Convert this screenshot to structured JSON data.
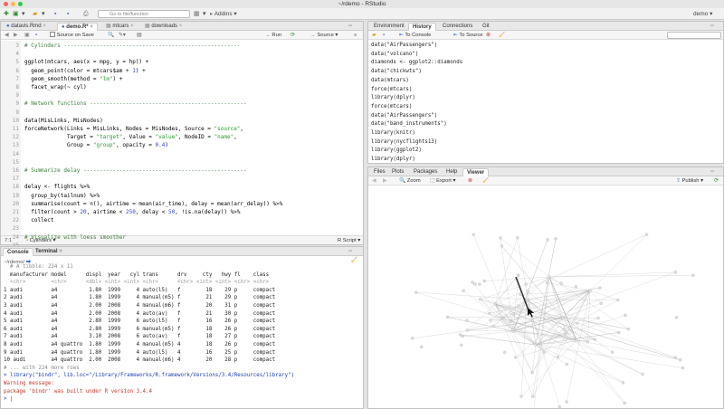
{
  "window": {
    "title": "~/rdemo - RStudio"
  },
  "toolbar": {
    "goto_placeholder": "Go to file/function",
    "addins_label": "Addins",
    "project_label": "demo"
  },
  "source": {
    "tabs": [
      {
        "label": "datavis.Rmd"
      },
      {
        "label": "demo.R*"
      },
      {
        "label": "mtcars"
      },
      {
        "label": "downloads"
      }
    ],
    "source_on_save": "Source on Save",
    "run_label": "Run",
    "source_label": "Source",
    "lines": [
      {
        "n": "3",
        "html": "<span class=\"cmt\"># Cylinders ------------------------------------------------------</span>"
      },
      {
        "n": "4",
        "html": ""
      },
      {
        "n": "5",
        "html": "ggplot(mtcars, aes(x = mpg, y = hp)) +"
      },
      {
        "n": "6",
        "html": "  geom_point(color = mtcars$am + <span class=\"num\">1</span>) +"
      },
      {
        "n": "7",
        "html": "  geom_smooth(method = <span class=\"str\">\"lm\"</span>) +"
      },
      {
        "n": "8",
        "html": "  facet_wrap(~ cyl)"
      },
      {
        "n": "9",
        "html": ""
      },
      {
        "n": "9",
        "html": "<span class=\"cmt\"># Network functions ------------------------------------------------</span>"
      },
      {
        "n": "9",
        "html": ""
      },
      {
        "n": "10",
        "html": "data(MisLinks, MisNodes)"
      },
      {
        "n": "11",
        "html": "forceNetwork(Links = MisLinks, Nodes = MisNodes, Source = <span class=\"str\">\"source\"</span>,"
      },
      {
        "n": "12",
        "html": "             Target = <span class=\"str\">\"target\"</span>, Value = <span class=\"str\">\"value\"</span>, NodeID = <span class=\"str\">\"name\"</span>,"
      },
      {
        "n": "13",
        "html": "             Group = <span class=\"str\">\"group\"</span>, opacity = <span class=\"num\">0.4</span>)"
      },
      {
        "n": "14",
        "html": ""
      },
      {
        "n": "15",
        "html": ""
      },
      {
        "n": "16",
        "html": "<span class=\"cmt\"># Summarize delay --------------------------------------------------</span>"
      },
      {
        "n": "17",
        "html": ""
      },
      {
        "n": "18",
        "html": "delay &lt;- flights %&gt;%"
      },
      {
        "n": "19",
        "html": "  group_by(tailnum) %&gt;%"
      },
      {
        "n": "20",
        "html": "  summarise(count = n(), airtime = mean(air_time), delay = mean(arr_delay)) %&gt;%"
      },
      {
        "n": "21",
        "html": "  filter(count &gt; <span class=\"num\">20</span>, airtime &lt; <span class=\"num\">250</span>, delay &lt; <span class=\"num\">50</span>, !is.na(delay)) %&gt;%"
      },
      {
        "n": "22",
        "html": "  collect"
      },
      {
        "n": "23",
        "html": ""
      },
      {
        "n": "24",
        "html": "<span class=\"cmt\"># Visualize with loess smoother</span>"
      },
      {
        "n": "25",
        "html": ""
      }
    ],
    "status_pos": "7:1",
    "status_section": "Cylinders",
    "status_type": "R Script"
  },
  "console": {
    "tabs": [
      {
        "label": "Console"
      },
      {
        "label": "Terminal"
      }
    ],
    "path": "~/rdemo/",
    "lines": [
      {
        "text": "  # A tibble: 234 x 11",
        "c": "#888"
      },
      {
        "text": "  manufacturer model      displ  year   cyl trans      drv     cty   hwy fl    class",
        "c": "#222"
      },
      {
        "text": "  <chr>        <chr>      <dbl> <int> <int> <chr>      <chr> <int> <int> <chr> <chr>",
        "c": "#999"
      },
      {
        "text": "1 audi         a4          1.80  1999     4 auto(l5)   f        18    29 p     compact",
        "c": "#222"
      },
      {
        "text": "2 audi         a4          1.80  1999     4 manual(m5) f        21    29 p     compact",
        "c": "#222"
      },
      {
        "text": "3 audi         a4          2.00  2008     4 manual(m6) f        20    31 p     compact",
        "c": "#222"
      },
      {
        "text": "4 audi         a4          2.00  2008     4 auto(av)   f        21    30 p     compact",
        "c": "#222"
      },
      {
        "text": "5 audi         a4          2.80  1999     6 auto(l5)   f        16    26 p     compact",
        "c": "#222"
      },
      {
        "text": "6 audi         a4          2.80  1999     6 manual(m5) f        18    26 p     compact",
        "c": "#222"
      },
      {
        "text": "7 audi         a4          3.10  2008     6 auto(av)   f        18    27 p     compact",
        "c": "#222"
      },
      {
        "text": "8 audi         a4 quattro  1.80  1999     4 manual(m5) 4        18    26 p     compact",
        "c": "#222"
      },
      {
        "text": "9 audi         a4 quattro  1.80  1999     4 auto(l5)   4        16    25 p     compact",
        "c": "#222"
      },
      {
        "text": "10 audi        a4 quattro  2.00  2008     4 manual(m6) 4        20    28 p     compact",
        "c": "#222"
      },
      {
        "text": "# ... with 224 more rows",
        "c": "#888"
      },
      {
        "text": "> library(\"bindr\", lib.loc=\"/Library/Frameworks/R.framework/Versions/3.4/Resources/library\")",
        "c": "#1a3fb0"
      },
      {
        "text": "Warning message:",
        "c": "#c0392b"
      },
      {
        "text": "package 'bindr' was built under R version 3.4.4",
        "c": "#c0392b"
      },
      {
        "text": "> |",
        "c": "#1a3fb0"
      }
    ]
  },
  "env": {
    "tabs": [
      {
        "label": "Environment"
      },
      {
        "label": "History"
      },
      {
        "label": "Connections"
      },
      {
        "label": "Git"
      }
    ],
    "to_console": "To Console",
    "to_source": "To Source",
    "history": [
      "data(\"AirPassengers\")",
      "data(\"volcano\")",
      "diamonds <- ggplot2::diamonds",
      "data(\"chickwts\")",
      "data(mtcars)",
      "force(mtcars)",
      "library(dplyr)",
      "force(mtcars)",
      "data(\"AirPassengers\")",
      "data(\"band_instruments\")",
      "library(knitr)",
      "library(nycflights13)",
      "library(ggplot2)",
      "library(dplyr)"
    ]
  },
  "viewer": {
    "tabs": [
      {
        "label": "Files"
      },
      {
        "label": "Plots"
      },
      {
        "label": "Packages"
      },
      {
        "label": "Help"
      },
      {
        "label": "Viewer"
      }
    ],
    "zoom": "Zoom",
    "export": "Export",
    "publish": "Publish"
  }
}
